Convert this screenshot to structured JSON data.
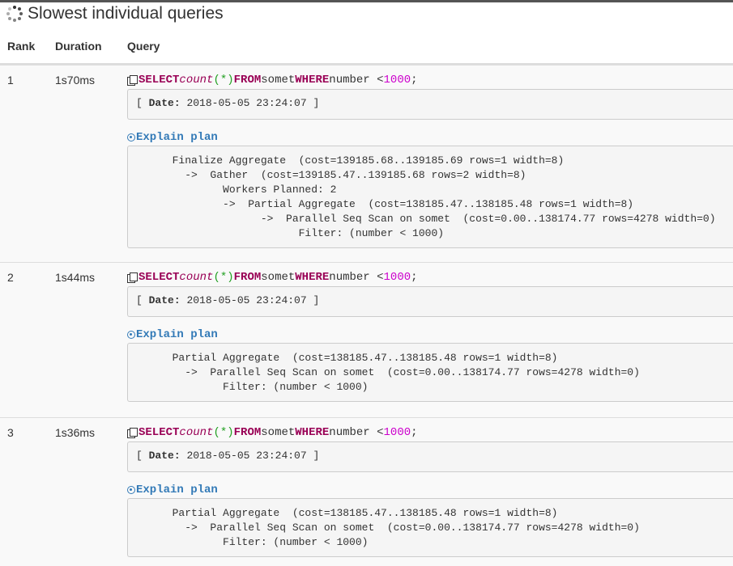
{
  "page": {
    "title": "Slowest individual queries"
  },
  "table": {
    "headers": {
      "rank": "Rank",
      "duration": "Duration",
      "query": "Query"
    },
    "rows": [
      {
        "rank": "1",
        "duration": "1s70ms",
        "query": {
          "kw1": "SELECT",
          "fn": "count",
          "parens": "(*)",
          "kw2": "FROM",
          "table": "somet",
          "kw3": "WHERE",
          "cond": "number <",
          "num": "1000",
          "end": ";"
        },
        "date_label": "Date:",
        "date_value": "2018-05-05 23:24:07",
        "explain_label": "Explain plan",
        "plan": [
          "       Finalize Aggregate  (cost=139185.68..139185.69 rows=1 width=8)",
          "         ->  Gather  (cost=139185.47..139185.68 rows=2 width=8)",
          "               Workers Planned: 2",
          "               ->  Partial Aggregate  (cost=138185.47..138185.48 rows=1 width=8)",
          "                     ->  Parallel Seq Scan on somet  (cost=0.00..138174.77 rows=4278 width=0)",
          "                           Filter: (number < 1000)"
        ]
      },
      {
        "rank": "2",
        "duration": "1s44ms",
        "query": {
          "kw1": "SELECT",
          "fn": "count",
          "parens": "(*)",
          "kw2": "FROM",
          "table": "somet",
          "kw3": "WHERE",
          "cond": "number <",
          "num": "1000",
          "end": ";"
        },
        "date_label": "Date:",
        "date_value": "2018-05-05 23:24:07",
        "explain_label": "Explain plan",
        "plan": [
          "       Partial Aggregate  (cost=138185.47..138185.48 rows=1 width=8)",
          "         ->  Parallel Seq Scan on somet  (cost=0.00..138174.77 rows=4278 width=0)",
          "               Filter: (number < 1000)"
        ]
      },
      {
        "rank": "3",
        "duration": "1s36ms",
        "query": {
          "kw1": "SELECT",
          "fn": "count",
          "parens": "(*)",
          "kw2": "FROM",
          "table": "somet",
          "kw3": "WHERE",
          "cond": "number <",
          "num": "1000",
          "end": ";"
        },
        "date_label": "Date:",
        "date_value": "2018-05-05 23:24:07",
        "explain_label": "Explain plan",
        "plan": [
          "       Partial Aggregate  (cost=138185.47..138185.48 rows=1 width=8)",
          "         ->  Parallel Seq Scan on somet  (cost=0.00..138174.77 rows=4278 width=0)",
          "               Filter: (number < 1000)"
        ]
      }
    ]
  },
  "icons": {
    "title": "spinner-icon",
    "copy": "copy-icon",
    "explain": "explain-icon"
  },
  "colors": {
    "keyword": "#990055",
    "paren": "#22a022",
    "number": "#cc00cc",
    "link": "#337ab7",
    "row_bg": "#f9f9f9",
    "box_bg": "#f5f5f5"
  }
}
